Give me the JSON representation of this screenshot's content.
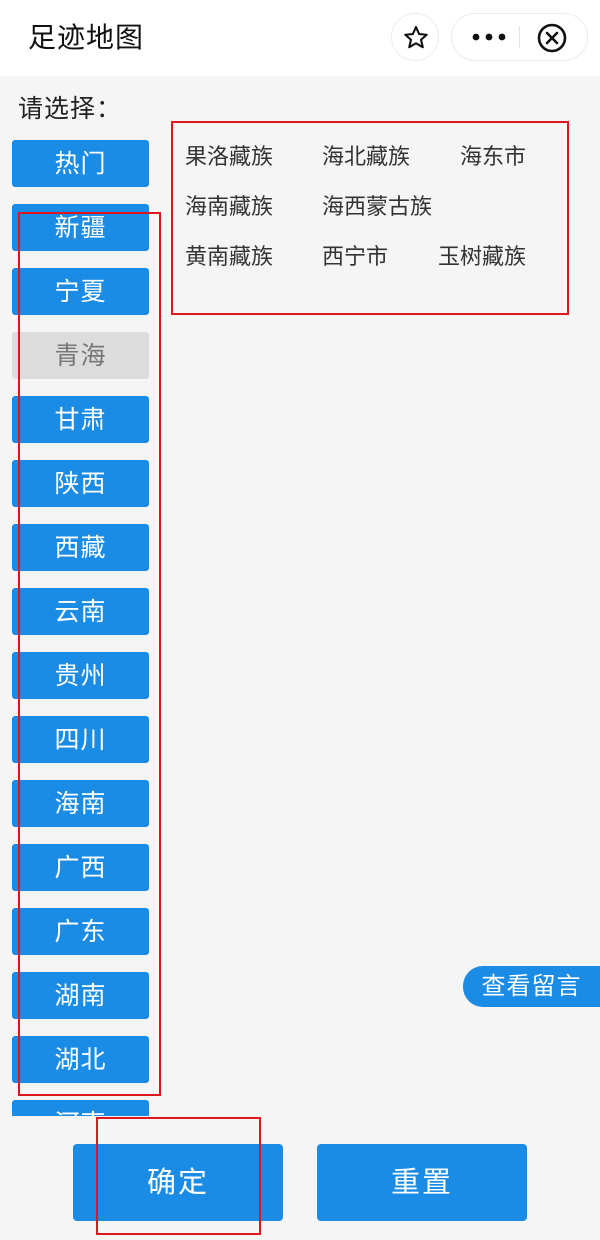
{
  "header": {
    "title": "足迹地图",
    "icons": {
      "favorite": "star-icon",
      "more": "more-dots-icon",
      "close": "close-circle-icon"
    }
  },
  "prompt": "请选择：",
  "provinces": {
    "items": [
      {
        "label": "热门",
        "selected": false
      },
      {
        "label": "新疆",
        "selected": false
      },
      {
        "label": "宁夏",
        "selected": false
      },
      {
        "label": "青海",
        "selected": true
      },
      {
        "label": "甘肃",
        "selected": false
      },
      {
        "label": "陕西",
        "selected": false
      },
      {
        "label": "西藏",
        "selected": false
      },
      {
        "label": "云南",
        "selected": false
      },
      {
        "label": "贵州",
        "selected": false
      },
      {
        "label": "四川",
        "selected": false
      },
      {
        "label": "海南",
        "selected": false
      },
      {
        "label": "广西",
        "selected": false
      },
      {
        "label": "广东",
        "selected": false
      },
      {
        "label": "湖南",
        "selected": false
      },
      {
        "label": "湖北",
        "selected": false
      },
      {
        "label": "河南",
        "selected": false
      }
    ]
  },
  "cities": {
    "items": [
      {
        "label": "果洛藏族"
      },
      {
        "label": "海北藏族"
      },
      {
        "label": "海东市"
      },
      {
        "label": "海南藏族"
      },
      {
        "label": "海西蒙古族"
      },
      {
        "label": "黄南藏族"
      },
      {
        "label": "西宁市"
      },
      {
        "label": "玉树藏族"
      }
    ]
  },
  "fab": {
    "label": "查看留言"
  },
  "actions": {
    "confirm_label": "确定",
    "reset_label": "重置"
  },
  "colors": {
    "accent": "#1a8ce6",
    "selected_bg": "#dcdcdc",
    "highlight_red": "#e0161f"
  }
}
